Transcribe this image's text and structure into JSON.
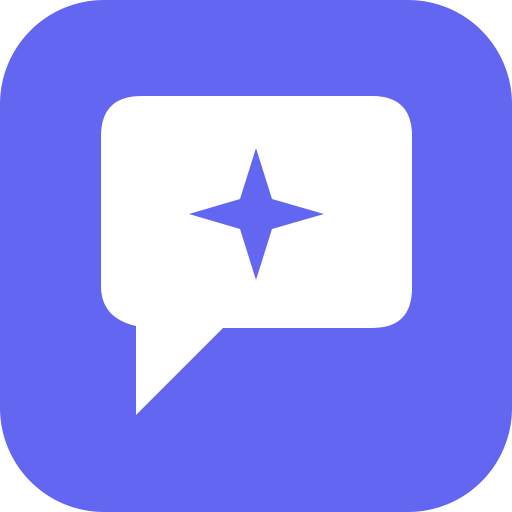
{
  "app_icon": {
    "name": "chat-sparkle-app-icon",
    "background_color": "#6366F1",
    "bubble_color": "#FFFFFF",
    "sparkle_color": "#6366F1",
    "icons": [
      "chat-bubble-icon",
      "sparkle-icon"
    ]
  }
}
